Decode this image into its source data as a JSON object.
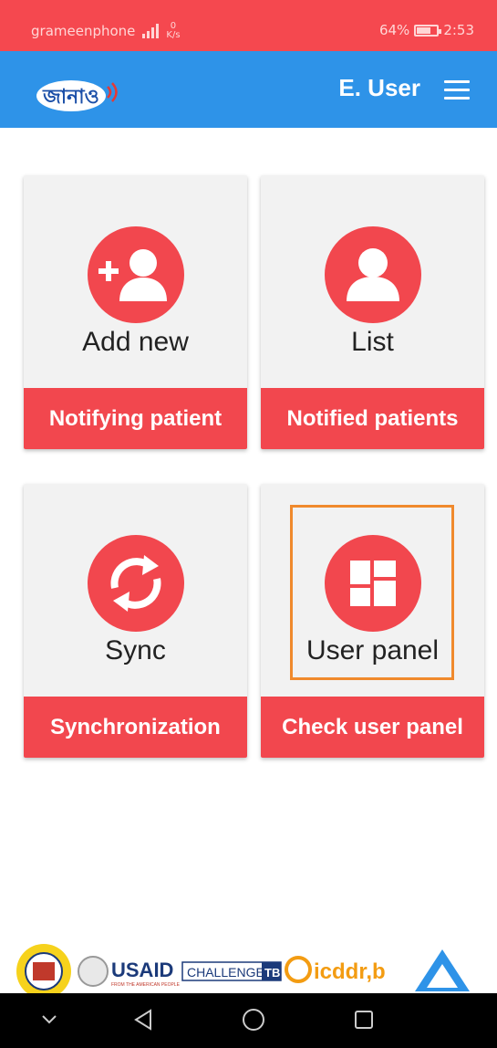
{
  "status_bar": {
    "carrier": "grameenphone",
    "net_speed_value": "0",
    "net_speed_unit": "K/s",
    "battery": "64%",
    "battery_level": 0.64,
    "time": "2:53"
  },
  "app_bar": {
    "logo_text": "জানাও",
    "user": "E. User"
  },
  "cards": [
    {
      "title": "Add new",
      "footer": "Notifying patient",
      "icon": "add-user-icon"
    },
    {
      "title": "List",
      "footer": "Notified patients",
      "icon": "user-icon"
    },
    {
      "title": "Sync",
      "footer": "Synchronization",
      "icon": "sync-icon"
    },
    {
      "title": "User panel",
      "footer": "Check user panel",
      "icon": "dashboard-icon"
    }
  ],
  "footer_logos": {
    "usaid": "USAID",
    "usaid_tagline": "FROM THE AMERICAN PEOPLE",
    "challenge": "CHALLENGE",
    "tb": "TB",
    "icddrb": "icddr,b"
  },
  "colors": {
    "status_bar": "#f5484f",
    "app_bar": "#2e93e8",
    "accent": "#f2474e",
    "highlight": "#f08a2d"
  }
}
